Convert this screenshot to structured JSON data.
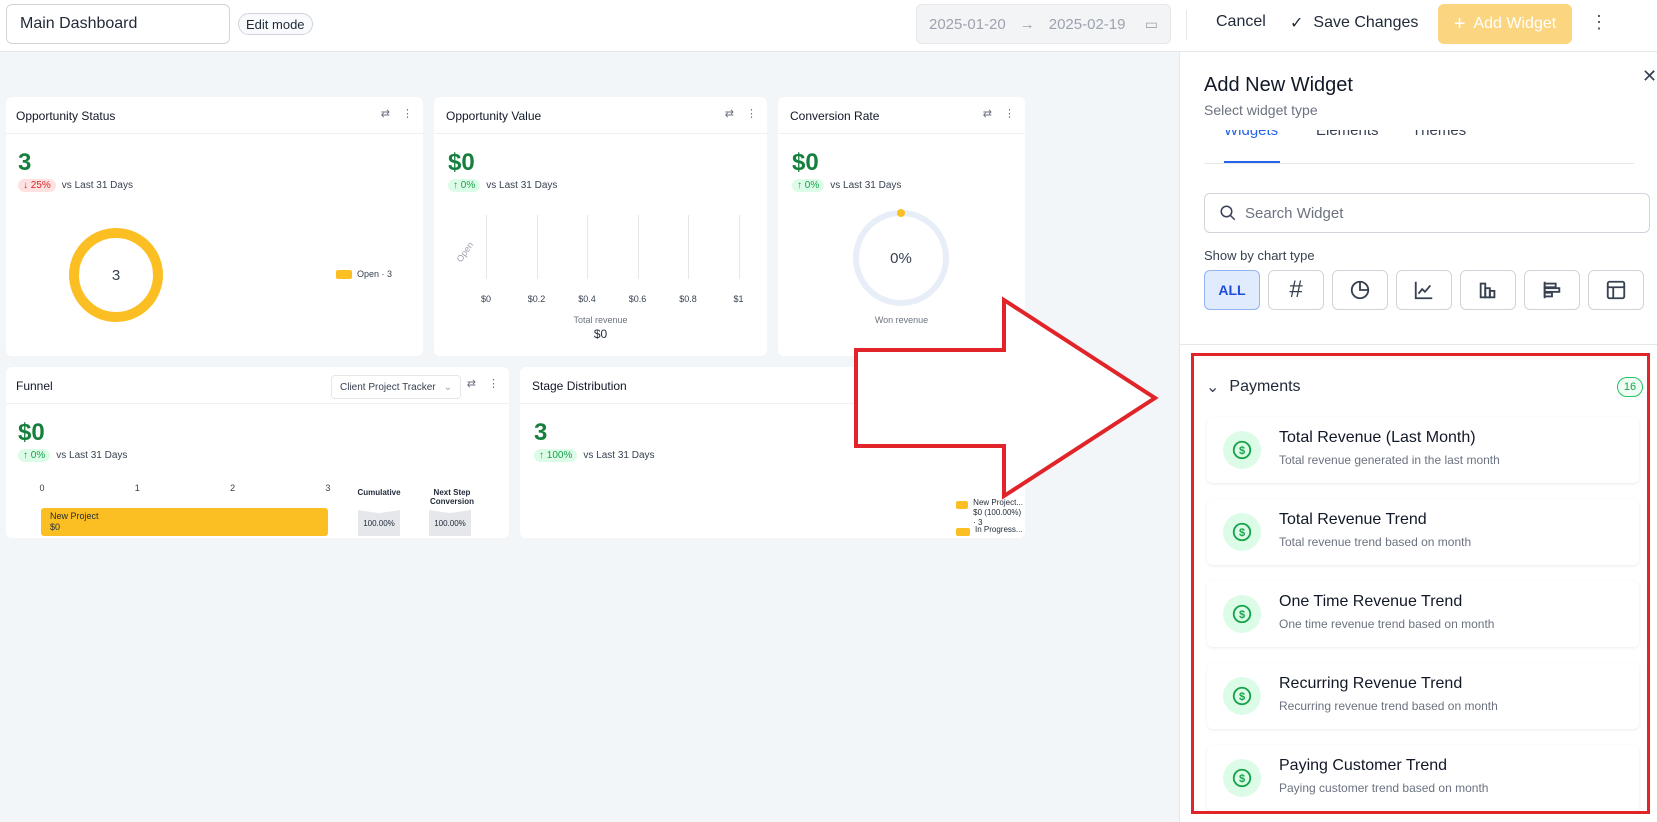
{
  "topbar": {
    "dashboard_name": "Main Dashboard",
    "edit_mode": "Edit mode",
    "date_from": "2025-01-20",
    "date_to": "2025-02-19",
    "cancel": "Cancel",
    "save": "Save Changes",
    "add_widget": "Add Widget"
  },
  "cards": {
    "opp_status": {
      "title": "Opportunity Status",
      "value": "3",
      "pct": "↓ 25%",
      "compare": "vs Last 31 Days",
      "donut_value": "3",
      "legend": "Open · 3"
    },
    "opp_value": {
      "title": "Opportunity Value",
      "value": "$0",
      "pct": "↑ 0%",
      "compare": "vs Last 31 Days",
      "y_label": "Open",
      "x_ticks": [
        "$0",
        "$0.2",
        "$0.4",
        "$0.6",
        "$0.8",
        "$1"
      ],
      "total_label": "Total revenue",
      "total_value": "$0"
    },
    "conversion": {
      "title": "Conversion Rate",
      "value": "$0",
      "pct": "↑ 0%",
      "compare": "vs Last 31 Days",
      "gauge_value": "0%",
      "gauge_label": "Won revenue"
    },
    "funnel": {
      "title": "Funnel",
      "pipeline": "Client Project Tracker",
      "value": "$0",
      "pct": "↑ 0%",
      "compare": "vs Last 31 Days",
      "x_ticks": [
        "0",
        "1",
        "2",
        "3"
      ],
      "bar_label": "New Project",
      "bar_value": "$0",
      "cumulative_label": "Cumulative",
      "next_step_label_1": "Next Step",
      "next_step_label_2": "Conversion",
      "cumulative_value": "100.00%",
      "next_step_value": "100.00%"
    },
    "stage": {
      "title": "Stage Distribution",
      "value": "3",
      "pct": "↑ 100%",
      "compare": "vs Last 31 Days",
      "legend1_a": "New Project...",
      "legend1_b": "$0 (100.00%) · 3",
      "legend2": "In Progress..."
    }
  },
  "panel": {
    "title": "Add New Widget",
    "subtitle": "Select widget type",
    "tabs": [
      "Widgets",
      "Elements",
      "Themes"
    ],
    "search_placeholder": "Search Widget",
    "chart_type_label": "Show by chart type",
    "all_label": "ALL",
    "section": {
      "name": "Payments",
      "count": "16"
    },
    "items": [
      {
        "title": "Total Revenue (Last Month)",
        "desc": "Total revenue generated in the last month"
      },
      {
        "title": "Total Revenue Trend",
        "desc": "Total revenue trend based on month"
      },
      {
        "title": "One Time Revenue Trend",
        "desc": "One time revenue trend based on month"
      },
      {
        "title": "Recurring Revenue Trend",
        "desc": "Recurring revenue trend based on month"
      },
      {
        "title": "Paying Customer Trend",
        "desc": "Paying customer trend based on month"
      }
    ]
  },
  "colors": {
    "accent_yellow": "#fbbf24",
    "green": "#15803d",
    "annotation_red": "#e0242a",
    "blue": "#2563eb"
  },
  "icons": [
    "calendar-icon",
    "check-icon",
    "plus-icon",
    "kebab-icon",
    "close-icon",
    "search-icon",
    "dollar-icon",
    "chevron-down-icon"
  ]
}
